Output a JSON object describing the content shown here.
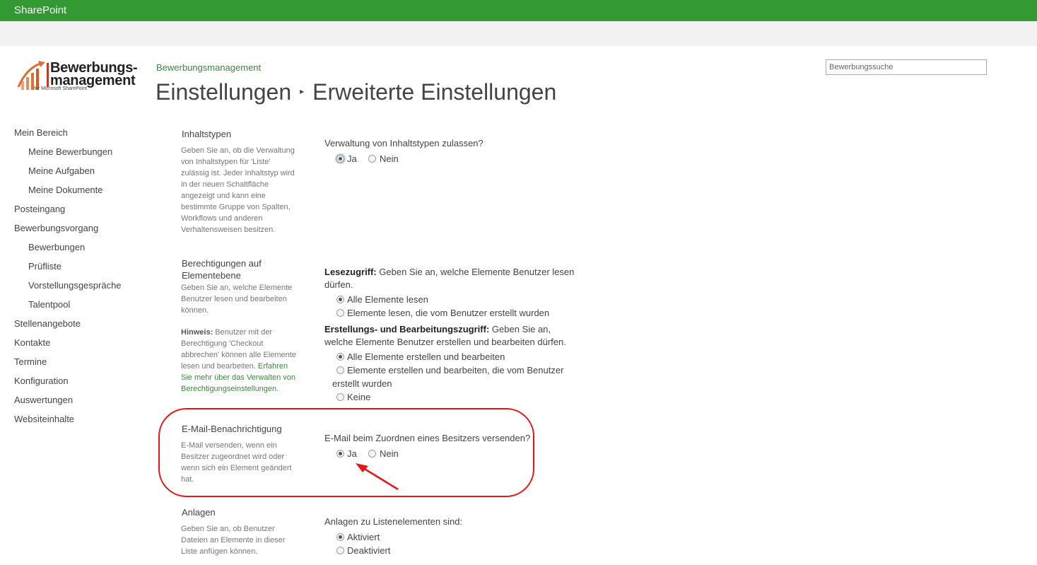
{
  "suite": {
    "brand": "SharePoint"
  },
  "logo": {
    "line1": "Bewerbungs-",
    "line2": "management",
    "sub": "for Microsoft SharePoint"
  },
  "header": {
    "site_link": "Bewerbungsmanagement",
    "title_part1": "Einstellungen",
    "separator": "▸",
    "title_part2": "Erweiterte Einstellungen",
    "search_placeholder": "Bewerbungssuche"
  },
  "nav": {
    "items": [
      {
        "label": "Mein Bereich"
      },
      {
        "label": "Meine Bewerbungen"
      },
      {
        "label": "Meine Aufgaben"
      },
      {
        "label": "Meine Dokumente"
      },
      {
        "label": "Posteingang"
      },
      {
        "label": "Bewerbungsvorgang"
      },
      {
        "label": "Bewerbungen"
      },
      {
        "label": "Prüfliste"
      },
      {
        "label": "Vorstellungsgespräche"
      },
      {
        "label": "Talentpool"
      },
      {
        "label": "Stellenangebote"
      },
      {
        "label": "Kontakte"
      },
      {
        "label": "Termine"
      },
      {
        "label": "Konfiguration"
      },
      {
        "label": "Auswertungen"
      },
      {
        "label": "Websiteinhalte"
      }
    ]
  },
  "sections": {
    "content_types": {
      "title": "Inhaltstypen",
      "desc_lines": [
        "Geben Sie an, ob die Verwaltung",
        "von Inhaltstypen für 'Liste'",
        "zulässig ist. Jeder Inhaltstyp wird",
        "in der neuen Schaltfläche",
        "angezeigt und kann eine",
        "bestimmte Gruppe von Spalten,",
        "Workflows und anderen",
        "Verhaltensweisen besitzen."
      ],
      "question": "Verwaltung von Inhaltstypen zulassen?",
      "opt_yes": "Ja",
      "opt_no": "Nein",
      "selected": "yes"
    },
    "item_permissions": {
      "title_line1": "Berechtigungen auf",
      "title_line2": "Elementebene",
      "desc_lines": [
        "Geben Sie an, welche Elemente",
        "Benutzer lesen und bearbeiten",
        "können."
      ],
      "hint_label": "Hinweis:",
      "hint_lines": [
        " Benutzer mit der",
        "Berechtigung 'Checkout",
        "abbrechen' können alle Elemente",
        "lesen und bearbeiten. "
      ],
      "hint_link1": "Erfahren",
      "hint_link2": "Sie mehr über das Verwalten von",
      "hint_link3": "Berechtigungseinstellungen",
      "hint_end": ".",
      "read_label": "Lesezugriff:",
      "read_text": "  Geben Sie an, welche Elemente Benutzer lesen dürfen.",
      "read_opt_all": "Alle Elemente lesen",
      "read_opt_own": "Elemente lesen, die vom Benutzer erstellt wurden",
      "read_selected": "all",
      "edit_label": "Erstellungs- und Bearbeitungszugriff:",
      "edit_text": "  Geben Sie an, welche Elemente Benutzer erstellen und bearbeiten dürfen.",
      "edit_opt_all": "Alle Elemente erstellen und bearbeiten",
      "edit_opt_own_line1": "Elemente erstellen und bearbeiten, die vom Benutzer",
      "edit_opt_own_line2": "erstellt wurden",
      "edit_opt_none": "Keine",
      "edit_selected": "all"
    },
    "email": {
      "title": "E-Mail-Benachrichtigung",
      "desc_lines": [
        "E-Mail versenden, wenn ein",
        "Besitzer zugeordnet wird oder",
        "wenn sich ein Element geändert",
        "hat."
      ],
      "question": "E-Mail beim Zuordnen eines Besitzers versenden?",
      "opt_yes": "Ja",
      "opt_no": "Nein",
      "selected": "yes"
    },
    "attachments": {
      "title": "Anlagen",
      "desc_lines": [
        "Geben Sie an, ob Benutzer",
        "Dateien an Elemente in dieser",
        "Liste anfügen können."
      ],
      "question": "Anlagen zu Listenelementen sind:",
      "opt_on": "Aktiviert",
      "opt_off": "Deaktiviert",
      "selected": "on"
    }
  },
  "annotation": {
    "highlight_color": "#e81616"
  },
  "colors": {
    "suite_bar": "#339933",
    "link": "#3a8a3a"
  }
}
